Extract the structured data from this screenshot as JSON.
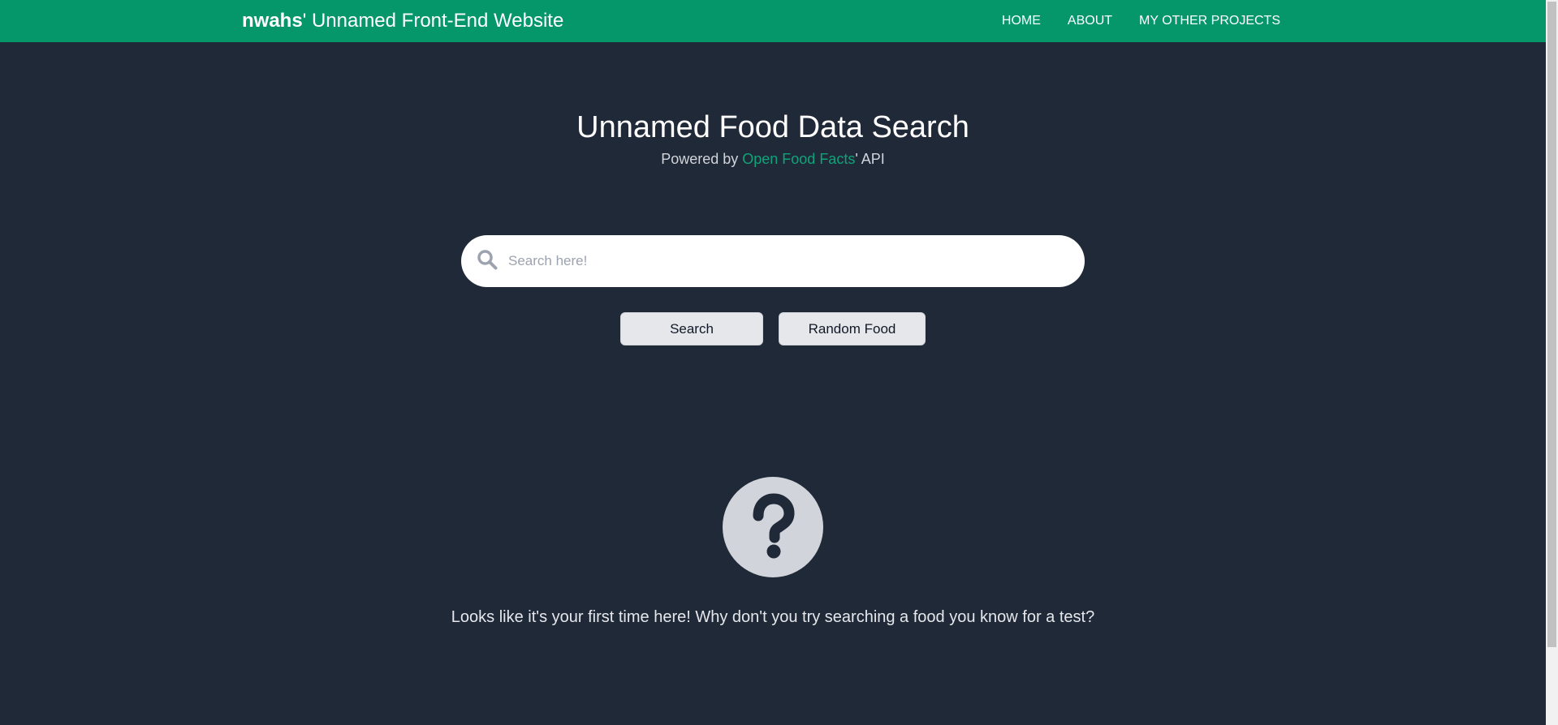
{
  "header": {
    "brand_bold": "nwahs",
    "brand_rest": "' Unnamed Front-End Website",
    "nav": [
      "HOME",
      "ABOUT",
      "MY OTHER PROJECTS"
    ]
  },
  "main": {
    "title": "Unnamed Food Data Search",
    "subtitle_prefix": "Powered by ",
    "subtitle_link": "Open Food Facts",
    "subtitle_suffix": "' API",
    "search": {
      "placeholder": "Search here!",
      "value": ""
    },
    "buttons": {
      "search": "Search",
      "random": "Random Food"
    },
    "empty_state_message": "Looks like it's your first time here! Why don't you try searching a food you know for a test?"
  },
  "icons": {
    "search": "search-icon",
    "empty_state": "question-circle-icon"
  },
  "colors": {
    "navbar": "#05976a",
    "background": "#1f2937",
    "link": "#10a37a",
    "button": "#e5e7eb"
  }
}
